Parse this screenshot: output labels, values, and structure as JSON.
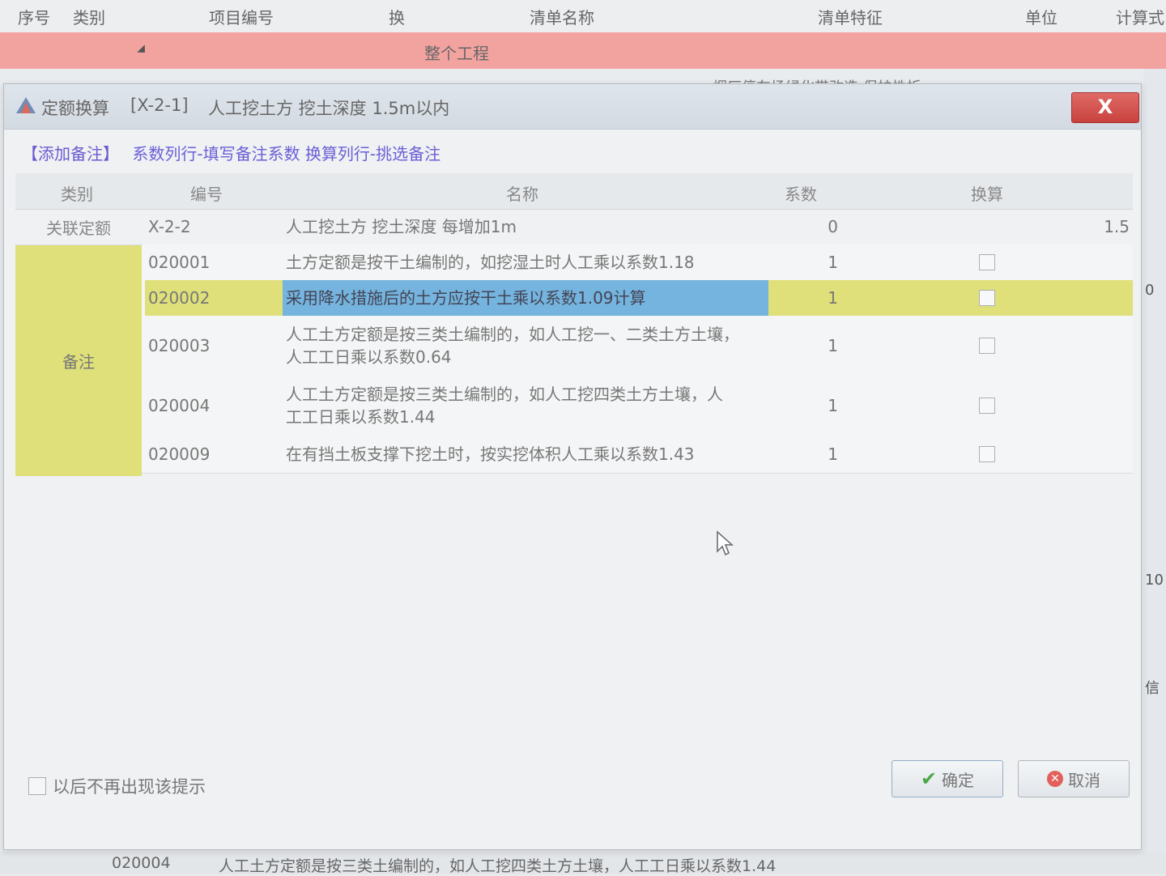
{
  "background": {
    "headers": [
      "序号",
      "类别",
      "项目编号",
      "换",
      "清单名称",
      "清单特征",
      "单位",
      "计算式"
    ],
    "project_row": "整个工程",
    "partial_text": "烟厂停车场绿化带改造  保护性拆",
    "right_partial": [
      "0",
      "10",
      "信"
    ],
    "bottom_row": {
      "code": "020004",
      "text": "人工土方定额是按三类土编制的，如人工挖四类土方土壤，人工工日乘以系数1.44"
    }
  },
  "dialog": {
    "title": "定额换算",
    "quota_code": "[X-2-1]",
    "quota_name": "人工挖土方 挖土深度 1.5m以内",
    "close_label": "X",
    "hint": {
      "add_note": "【添加备注】",
      "instructions": "系数列行-填写备注系数  换算列行-挑选备注"
    },
    "columns": [
      "类别",
      "编号",
      "名称",
      "系数",
      "换算"
    ],
    "categories": {
      "associated": "关联定额",
      "note": "备注"
    },
    "rows": [
      {
        "code": "X-2-2",
        "name": "人工挖土方 挖土深度 每增加1m",
        "coef": "0",
        "extra": "1.5"
      },
      {
        "code": "020001",
        "name": "土方定额是按干土编制的，如挖湿土时人工乘以系数1.18",
        "coef": "1"
      },
      {
        "code": "020002",
        "name": "采用降水措施后的土方应按干土乘以系数1.09计算",
        "coef": "1"
      },
      {
        "code": "020003",
        "name": "人工土方定额是按三类土编制的，如人工挖一、二类土方土壤，人工工日乘以系数0.64",
        "coef": "1"
      },
      {
        "code": "020004",
        "name": "人工土方定额是按三类土编制的，如人工挖四类土方土壤，人工工日乘以系数1.44",
        "coef": "1"
      },
      {
        "code": "020009",
        "name": "在有挡土板支撑下挖土时，按实挖体积人工乘以系数1.43",
        "coef": "1"
      }
    ],
    "footer": {
      "dont_show": "以后不再出现该提示",
      "ok": "确定",
      "cancel": "取消"
    }
  },
  "colors": {
    "project_row": "#f2a3a0",
    "highlight_yellow": "#dfe07a",
    "selection_blue": "#74b4de",
    "close_red": "#c8423e"
  }
}
